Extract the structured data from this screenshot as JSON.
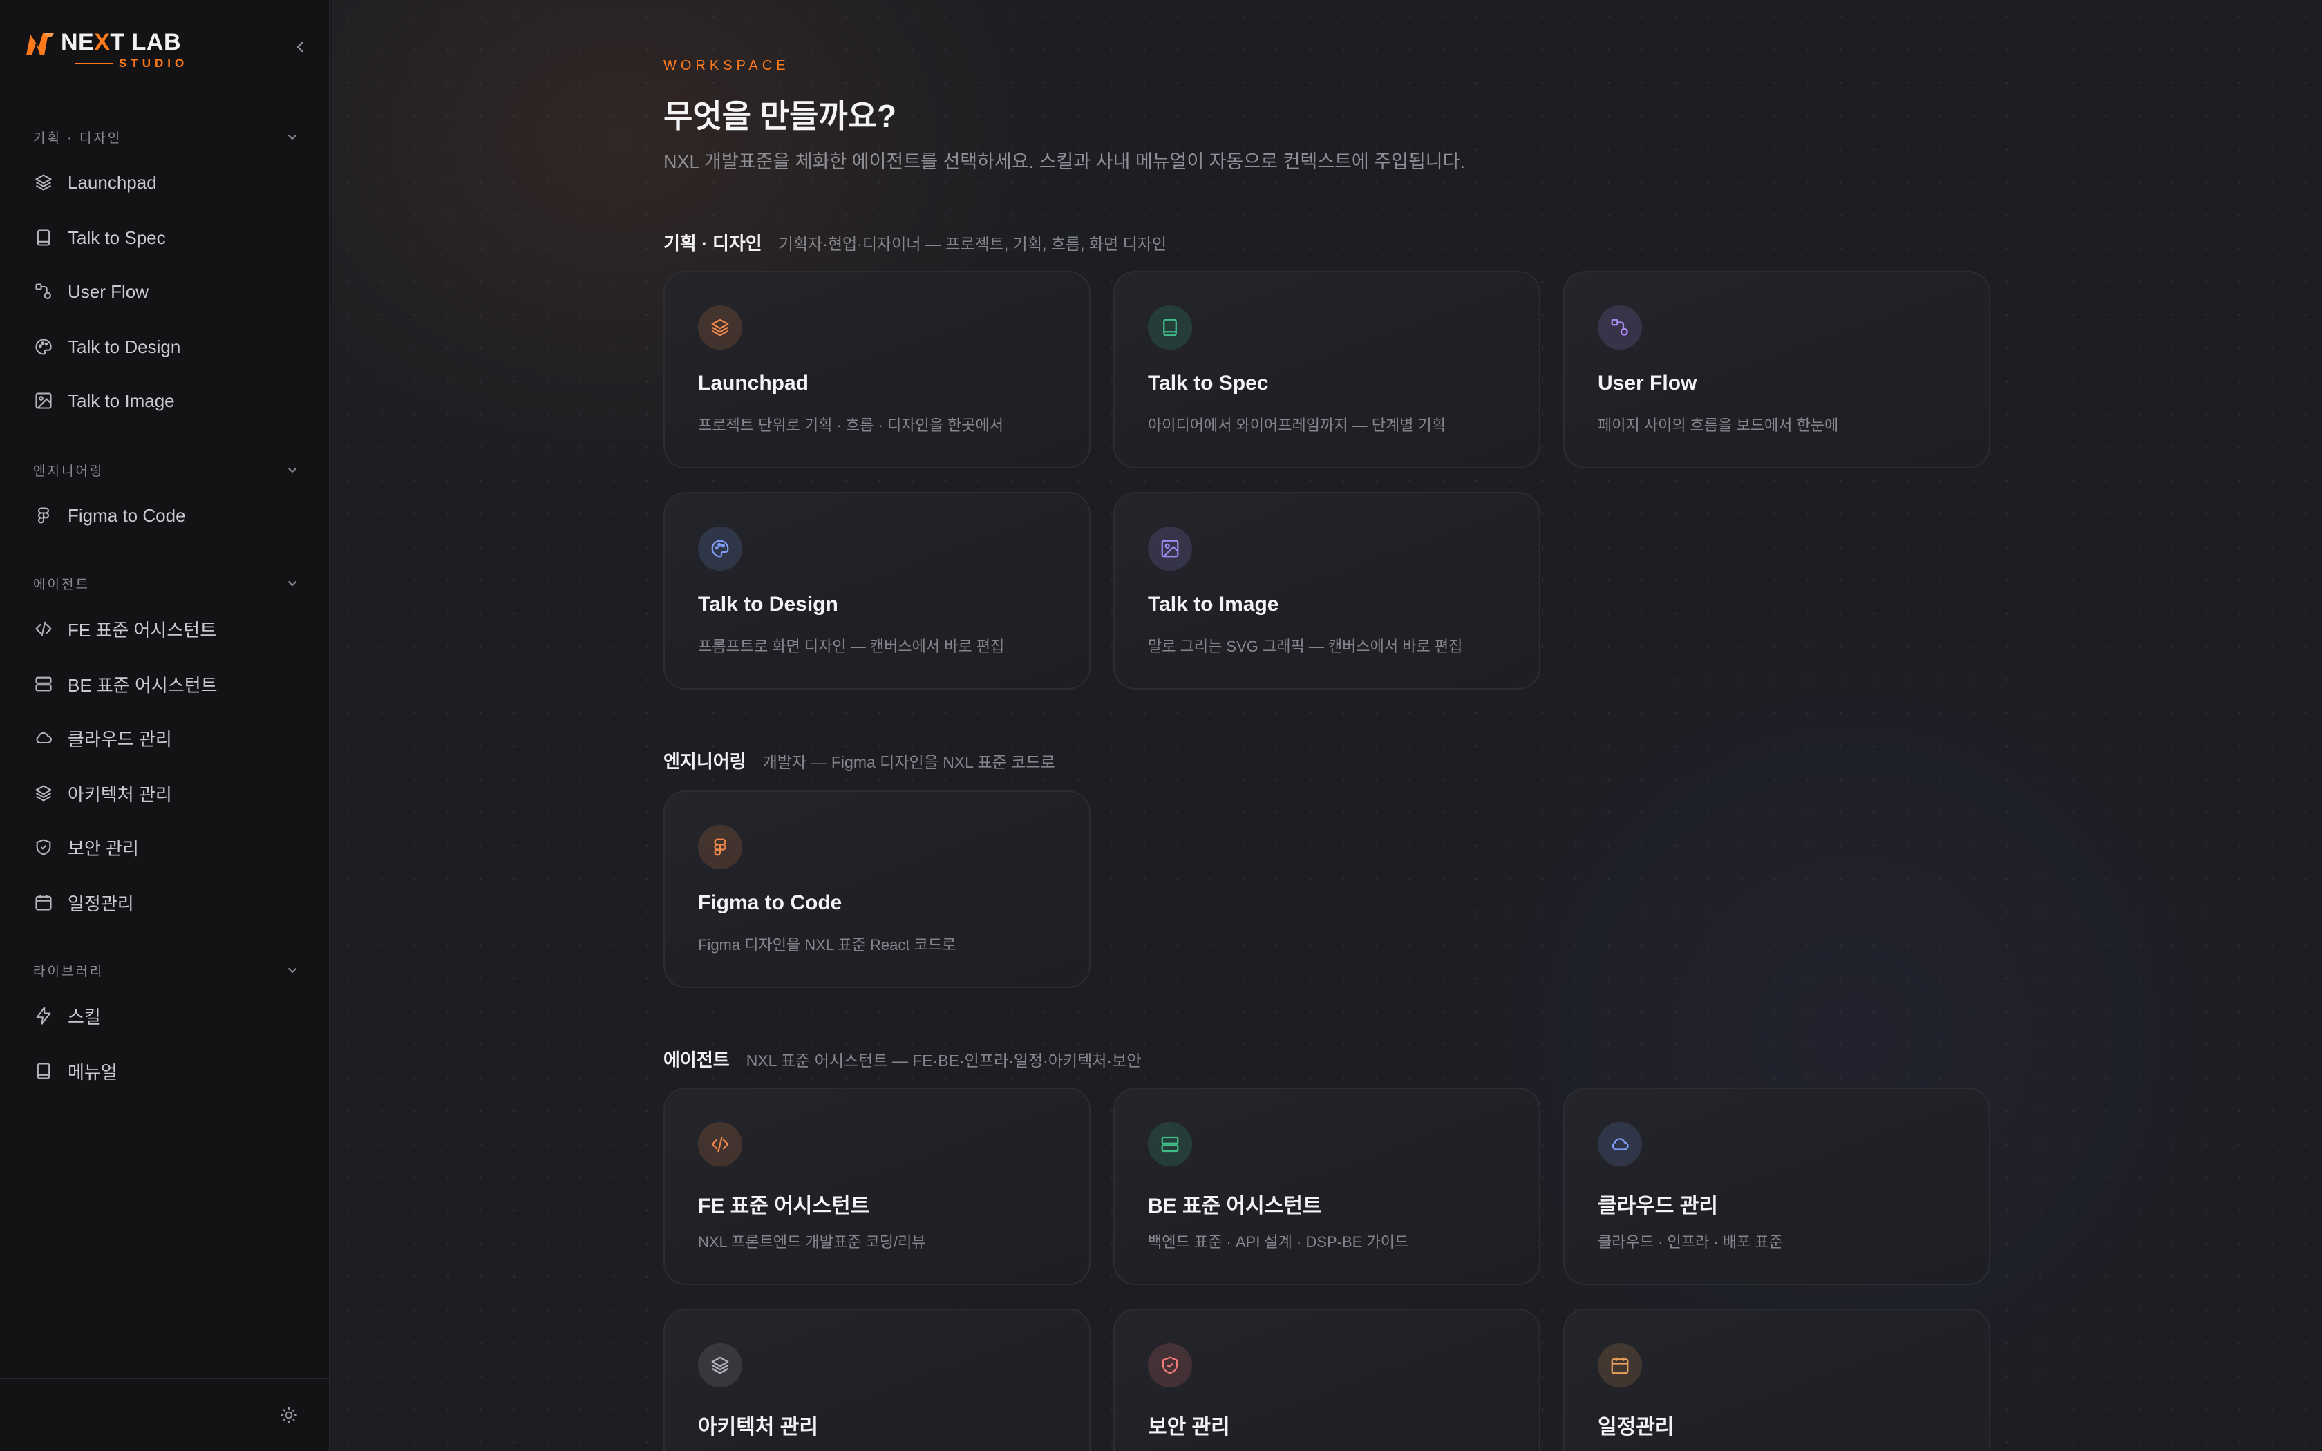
{
  "brand": {
    "name_pre": "NE",
    "name_x": "X",
    "name_post": "T LAB",
    "sub": "STUDIO",
    "accent": "#ff7a1a"
  },
  "sidebar": {
    "sections": [
      {
        "label": "기획 · 디자인",
        "items": [
          {
            "label": "Launchpad",
            "icon": "layers-icon"
          },
          {
            "label": "Talk to Spec",
            "icon": "book-icon"
          },
          {
            "label": "User Flow",
            "icon": "flow-icon"
          },
          {
            "label": "Talk to Design",
            "icon": "palette-icon"
          },
          {
            "label": "Talk to Image",
            "icon": "image-icon"
          }
        ]
      },
      {
        "label": "엔지니어링",
        "items": [
          {
            "label": "Figma to Code",
            "icon": "figma-icon"
          }
        ]
      },
      {
        "label": "에이전트",
        "items": [
          {
            "label": "FE 표준 어시스턴트",
            "icon": "code-icon"
          },
          {
            "label": "BE 표준 어시스턴트",
            "icon": "server-icon"
          },
          {
            "label": "클라우드 관리",
            "icon": "cloud-icon"
          },
          {
            "label": "아키텍처 관리",
            "icon": "layers-icon"
          },
          {
            "label": "보안 관리",
            "icon": "shield-icon"
          },
          {
            "label": "일정관리",
            "icon": "calendar-icon"
          }
        ]
      },
      {
        "label": "라이브러리",
        "items": [
          {
            "label": "스킬",
            "icon": "bolt-icon"
          },
          {
            "label": "메뉴얼",
            "icon": "book-icon"
          }
        ]
      }
    ]
  },
  "header": {
    "eyebrow": "WORKSPACE",
    "title": "무엇을 만들까요?",
    "subtitle": "NXL 개발표준을 체화한 에이전트를 선택하세요. 스킬과 사내 메뉴얼이 자동으로 컨텍스트에 주입됩니다."
  },
  "groups": [
    {
      "title": "기획 · 디자인",
      "desc": "기획자·현업·디자이너 — 프로젝트, 기획, 흐름, 화면 디자인",
      "cards": [
        {
          "title": "Launchpad",
          "desc": "프로젝트 단위로 기획 · 흐름 · 디자인을 한곳에서",
          "icon": "layers-icon",
          "color": "#f08a4b"
        },
        {
          "title": "Talk to Spec",
          "desc": "아이디어에서 와이어프레임까지 — 단계별 기획",
          "icon": "book-icon",
          "color": "#3fbf8a"
        },
        {
          "title": "User Flow",
          "desc": "페이지 사이의 흐름을 보드에서 한눈에",
          "icon": "flow-icon",
          "color": "#a98bf0"
        }
      ]
    },
    {
      "cards": [
        {
          "title": "Talk to Design",
          "desc": "프롬프트로 화면 디자인 — 캔버스에서 바로 편집",
          "icon": "palette-icon",
          "color": "#7f9cf5"
        },
        {
          "title": "Talk to Image",
          "desc": "말로 그리는 SVG 그래픽 — 캔버스에서 바로 편집",
          "icon": "image-icon",
          "color": "#9a8cf0"
        }
      ]
    },
    {
      "title": "엔지니어링",
      "desc": "개발자 — Figma 디자인을 NXL 표준 코드로",
      "cards": [
        {
          "title": "Figma to Code",
          "desc": "Figma 디자인을 NXL 표준 React 코드로",
          "icon": "figma-icon",
          "color": "#f08a4b"
        }
      ]
    },
    {
      "title": "에이전트",
      "desc": "NXL 표준 어시스턴트 — FE·BE·인프라·일정·아키텍처·보안",
      "cards": [
        {
          "title": "FE 표준 어시스턴트",
          "desc": "NXL 프론트엔드 개발표준 코딩/리뷰",
          "icon": "code-icon",
          "color": "#f08a4b"
        },
        {
          "title": "BE 표준 어시스턴트",
          "desc": "백엔드 표준 · API 설계 · DSP-BE 가이드",
          "icon": "server-icon",
          "color": "#3fbf8a"
        },
        {
          "title": "클라우드 관리",
          "desc": "클라우드 · 인프라 · 배포 표준",
          "icon": "cloud-icon",
          "color": "#7f9cf5"
        }
      ]
    },
    {
      "cards": [
        {
          "title": "아키텍처 관리",
          "icon": "layers-icon",
          "color": "#b5b6bd"
        },
        {
          "title": "보안 관리",
          "icon": "shield-icon",
          "color": "#f07a7a"
        },
        {
          "title": "일정관리",
          "icon": "calendar-icon",
          "color": "#e8a25a"
        }
      ]
    }
  ]
}
